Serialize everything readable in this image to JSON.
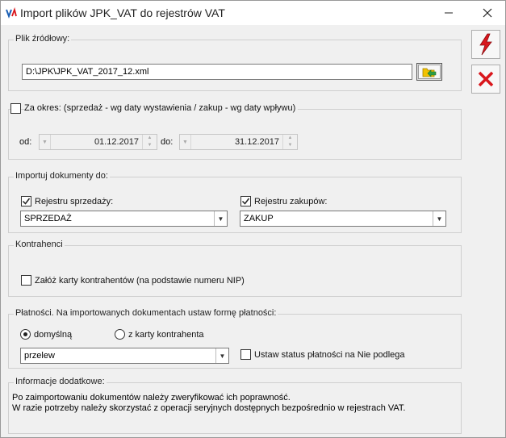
{
  "window": {
    "title": "Import plików JPK_VAT do rejestrów VAT"
  },
  "source": {
    "legend": "Plik źródłowy:",
    "path": "D:\\JPK\\JPK_VAT_2017_12.xml"
  },
  "period": {
    "legend": "Za okres: (sprzedaż - wg daty wystawienia / zakup - wg daty wpływu)",
    "checked": false,
    "from_label": "od:",
    "from_value": "01.12.2017",
    "to_label": "do:",
    "to_value": "31.12.2017"
  },
  "import_to": {
    "legend": "Importuj dokumenty do:",
    "sales_label": "Rejestru sprzedaży:",
    "sales_checked": true,
    "sales_value": "SPRZEDAŻ",
    "purchase_label": "Rejestru zakupów:",
    "purchase_checked": true,
    "purchase_value": "ZAKUP"
  },
  "contractors": {
    "legend": "Kontrahenci",
    "create_cards_label": "Załóż karty kontrahentów (na podstawie numeru NIP)",
    "create_cards_checked": false
  },
  "payments": {
    "legend": "Płatności. Na importowanych dokumentach ustaw formę płatności:",
    "radio_default": "domyślną",
    "radio_card": "z karty kontrahenta",
    "selected": "domyślną",
    "method_value": "przelew",
    "not_applicable_label": "Ustaw status płatności na Nie podlega",
    "not_applicable_checked": false
  },
  "info": {
    "legend": "Informacje dodatkowe:",
    "line1": "Po zaimportowaniu dokumentów należy zweryfikować ich poprawność.",
    "line2": "W razie potrzeby należy skorzystać z operacji seryjnych dostępnych bezpośrednio w rejestrach VAT."
  },
  "colors": {
    "accent_red": "#d9161c",
    "folder_yellow": "#f2c200",
    "folder_green": "#2e9e44"
  },
  "icons": {
    "run": "lightning-icon",
    "cancel": "red-x-icon",
    "browse": "folder-icon"
  }
}
